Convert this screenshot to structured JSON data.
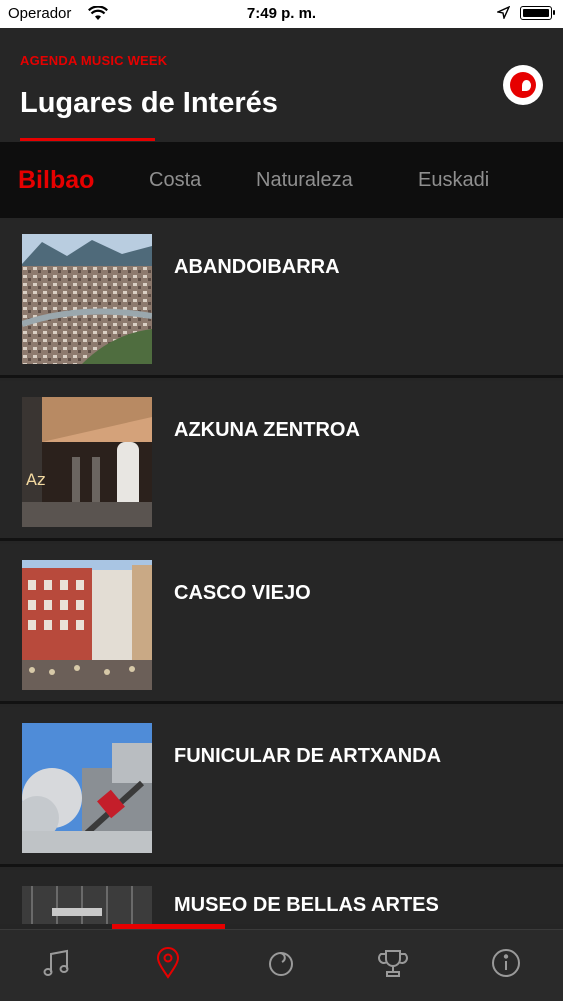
{
  "status_bar": {
    "carrier": "Operador",
    "time": "7:49 p. m."
  },
  "header": {
    "eyebrow": "AGENDA MUSIC WEEK",
    "title": "Lugares de Interés"
  },
  "tabs": [
    {
      "label": "Bilbao",
      "active": true
    },
    {
      "label": "Costa",
      "active": false
    },
    {
      "label": "Naturaleza",
      "active": false
    },
    {
      "label": "Euskadi",
      "active": false
    }
  ],
  "places": [
    {
      "name": "ABANDOIBARRA"
    },
    {
      "name": "AZKUNA ZENTROA"
    },
    {
      "name": "CASCO VIEJO"
    },
    {
      "name": "FUNICULAR DE ARTXANDA"
    },
    {
      "name": "MUSEO DE BELLAS ARTES"
    }
  ],
  "bottom_nav": [
    {
      "icon": "music-note-icon",
      "active": false
    },
    {
      "icon": "map-pin-icon",
      "active": true
    },
    {
      "icon": "vodafone-icon",
      "active": false
    },
    {
      "icon": "trophy-icon",
      "active": false
    },
    {
      "icon": "info-icon",
      "active": false
    }
  ],
  "colors": {
    "accent": "#e60000",
    "background": "#262626",
    "tab_bar": "#0e0e0e",
    "inactive": "#8f8f8f"
  }
}
